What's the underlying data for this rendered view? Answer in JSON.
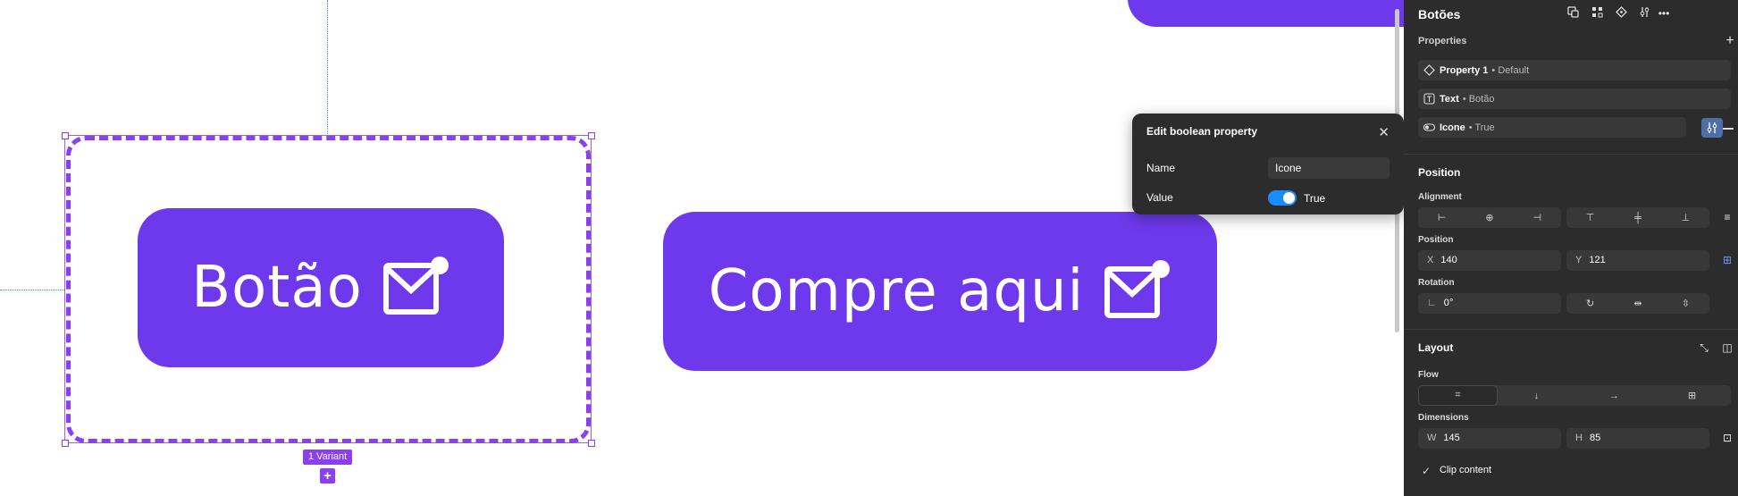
{
  "canvas": {
    "component_button": {
      "label": "Botão"
    },
    "instance_button": {
      "label": "Compre aqui"
    },
    "variant_badge": "1 Variant",
    "variant_add": "+"
  },
  "popover": {
    "title": "Edit boolean property",
    "name_label": "Name",
    "name_value": "Icone",
    "value_label": "Value",
    "toggle_value": "True",
    "toggle_on": true
  },
  "panel": {
    "title": "Botões",
    "properties": {
      "title": "Properties",
      "items": [
        {
          "name": "Property 1",
          "value": "• Default",
          "icon": "variant-diamond-icon"
        },
        {
          "name": "Text",
          "value": "• Botão",
          "icon": "text-property-icon"
        },
        {
          "name": "Icone",
          "value": "• True",
          "icon": "boolean-toggle-icon"
        }
      ]
    },
    "position": {
      "title": "Position",
      "alignment_label": "Alignment",
      "position_label": "Position",
      "x_label": "X",
      "x_value": "140",
      "y_label": "Y",
      "y_value": "121",
      "rotation_label": "Rotation",
      "rotation_value": "0°"
    },
    "layout": {
      "title": "Layout",
      "flow_label": "Flow",
      "dimensions_label": "Dimensions",
      "w_label": "W",
      "w_value": "145",
      "h_label": "H",
      "h_value": "85",
      "clip_content_label": "Clip content",
      "clip_content_checked": true
    }
  },
  "colors": {
    "brand_purple": "#6e39ec",
    "selection_purple": "#8b3ff0",
    "panel_bg": "#2c2c2c",
    "toggle_blue": "#1a8cff"
  }
}
